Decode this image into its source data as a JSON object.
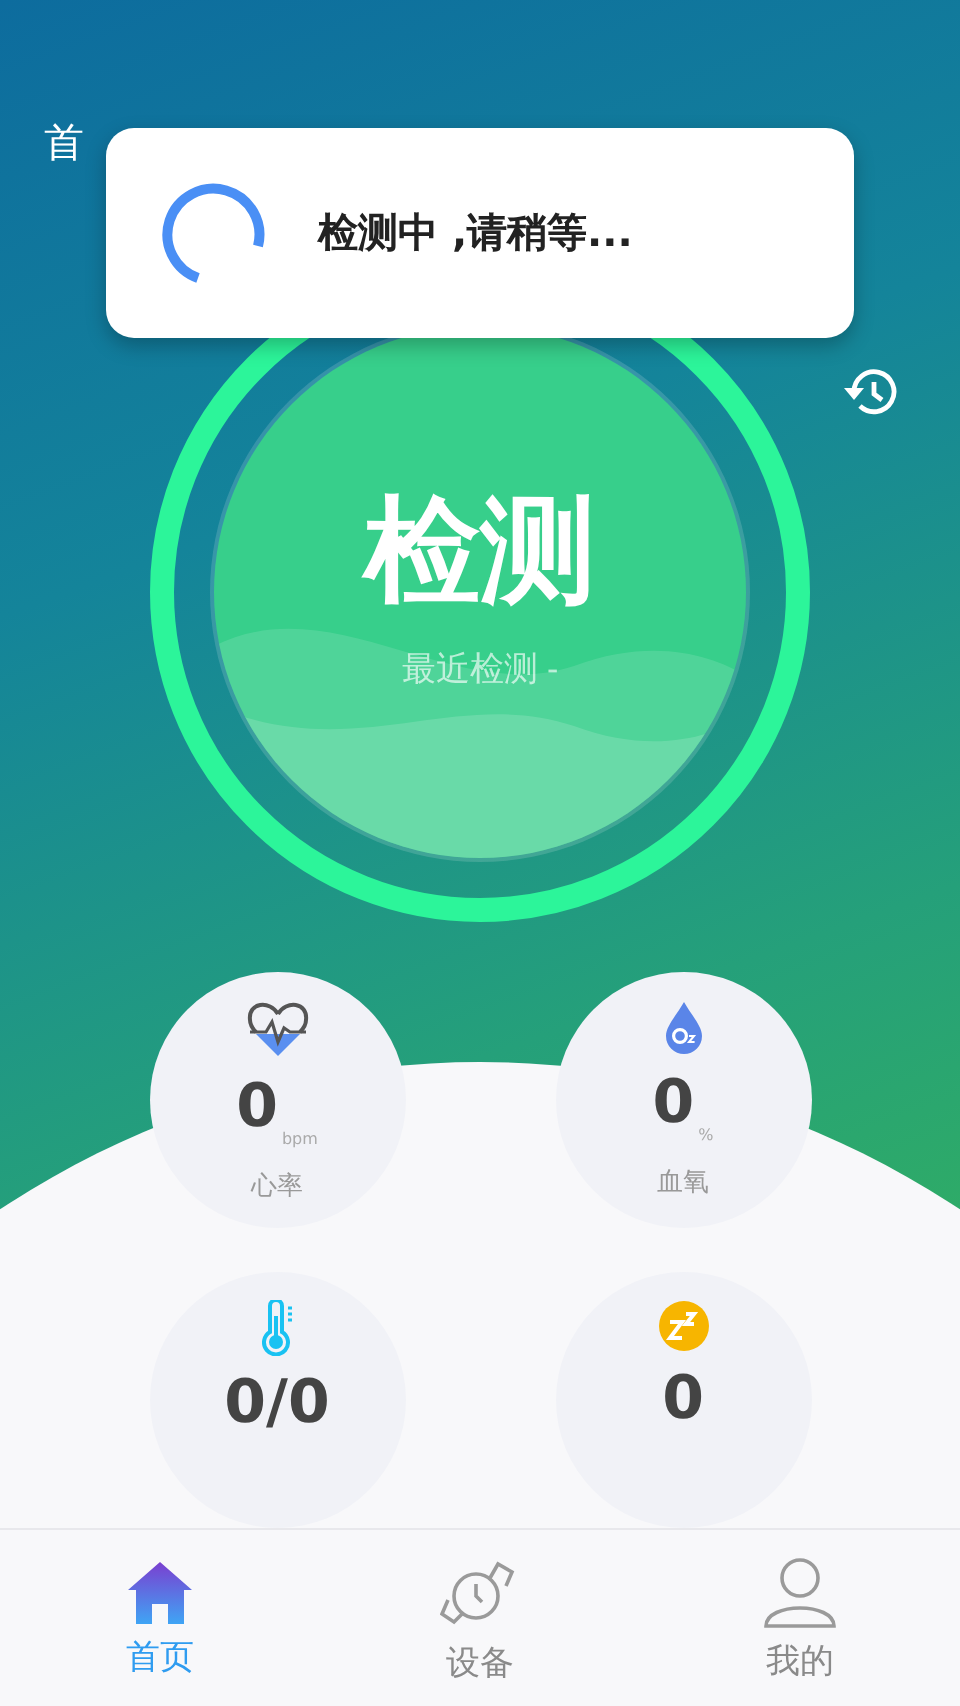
{
  "header": {
    "title": "首"
  },
  "toast": {
    "message": "检测中 ,请稍等..."
  },
  "detect": {
    "label": "检测",
    "subtitle": "最近检测 -"
  },
  "metrics": [
    {
      "kind": "heart",
      "value": "0",
      "unit": "bpm",
      "label": "心率"
    },
    {
      "kind": "oxygen",
      "value": "0",
      "unit": "%",
      "label": "血氧"
    },
    {
      "kind": "temperature",
      "value": "0/0"
    },
    {
      "kind": "sleep",
      "value": "0"
    }
  ],
  "tabs": [
    {
      "kind": "home",
      "label": "首页",
      "selected": true
    },
    {
      "kind": "device",
      "label": "设备",
      "selected": false
    },
    {
      "kind": "profile",
      "label": "我的",
      "selected": false
    }
  ]
}
